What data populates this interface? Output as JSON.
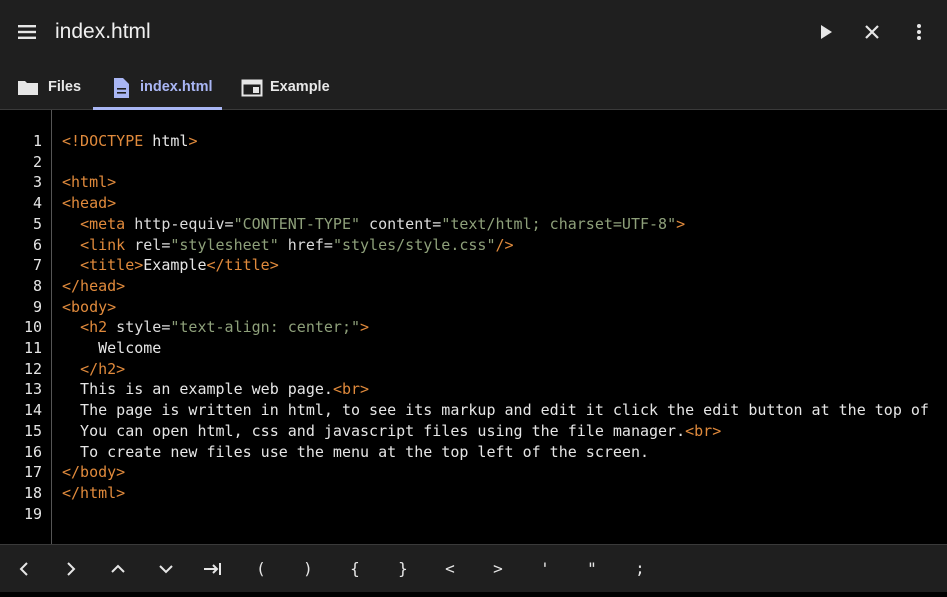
{
  "header": {
    "title": "index.html",
    "icons": {
      "menu": "hamburger-menu-icon",
      "run": "play-icon",
      "close": "close-icon",
      "more": "more-vert-icon"
    }
  },
  "tabs": [
    {
      "label": "Files",
      "icon": "folder-icon",
      "active": false
    },
    {
      "label": "index.html",
      "icon": "file-icon",
      "active": true
    },
    {
      "label": "Example",
      "icon": "web-preview-icon",
      "active": false
    }
  ],
  "colors": {
    "accent": "#a9b6f4",
    "tag": "#e08a3c",
    "string": "#8ea07a",
    "text": "#e6e6e6",
    "background": "#000000",
    "toolbar": "#1f1f1f"
  },
  "editor": {
    "lines": [
      [
        [
          "tag",
          "<!DOCTYPE"
        ],
        [
          "text",
          " html"
        ],
        [
          "tag",
          ">"
        ]
      ],
      [],
      [
        [
          "tag",
          "<html>"
        ]
      ],
      [
        [
          "tag",
          "<head>"
        ]
      ],
      [
        [
          "text",
          "  "
        ],
        [
          "tag",
          "<meta"
        ],
        [
          "attr",
          " http-equiv="
        ],
        [
          "str",
          "\"CONTENT-TYPE\""
        ],
        [
          "attr",
          " content="
        ],
        [
          "str",
          "\"text/html; charset=UTF-8\""
        ],
        [
          "tag",
          ">"
        ]
      ],
      [
        [
          "text",
          "  "
        ],
        [
          "tag",
          "<link"
        ],
        [
          "attr",
          " rel="
        ],
        [
          "str",
          "\"stylesheet\""
        ],
        [
          "attr",
          " href="
        ],
        [
          "str",
          "\"styles/style.css\""
        ],
        [
          "tag",
          "/>"
        ]
      ],
      [
        [
          "text",
          "  "
        ],
        [
          "tag",
          "<title>"
        ],
        [
          "text",
          "Example"
        ],
        [
          "tag",
          "</title>"
        ]
      ],
      [
        [
          "tag",
          "</head>"
        ]
      ],
      [
        [
          "tag",
          "<body>"
        ]
      ],
      [
        [
          "text",
          "  "
        ],
        [
          "tag",
          "<h2"
        ],
        [
          "attr",
          " style="
        ],
        [
          "str",
          "\"text-align: center;\""
        ],
        [
          "tag",
          ">"
        ]
      ],
      [
        [
          "text",
          "    Welcome"
        ]
      ],
      [
        [
          "text",
          "  "
        ],
        [
          "tag",
          "</h2>"
        ]
      ],
      [
        [
          "text",
          "  This is an example web page."
        ],
        [
          "tag",
          "<br>"
        ]
      ],
      [
        [
          "text",
          "  The page is written in html, to see its markup and edit it click the edit button at the top of"
        ]
      ],
      [
        [
          "text",
          "  You can open html, css and javascript files using the file manager."
        ],
        [
          "tag",
          "<br>"
        ]
      ],
      [
        [
          "text",
          "  To create new files use the menu at the top left of the screen."
        ]
      ],
      [
        [
          "tag",
          "</body>"
        ]
      ],
      [
        [
          "tag",
          "</html>"
        ]
      ],
      []
    ]
  },
  "keybar": {
    "keys": [
      {
        "name": "arrow-left-key",
        "label": "<",
        "icon": "chevron-left-icon"
      },
      {
        "name": "arrow-right-key",
        "label": ">",
        "icon": "chevron-right-icon"
      },
      {
        "name": "arrow-up-key",
        "label": "^",
        "icon": "chevron-up-icon"
      },
      {
        "name": "arrow-down-key",
        "label": "v",
        "icon": "chevron-down-icon"
      },
      {
        "name": "tab-key",
        "label": "→|",
        "icon": "tab-icon"
      },
      {
        "name": "open-paren-key",
        "label": "("
      },
      {
        "name": "close-paren-key",
        "label": ")"
      },
      {
        "name": "open-brace-key",
        "label": "{"
      },
      {
        "name": "close-brace-key",
        "label": "}"
      },
      {
        "name": "less-than-key",
        "label": "<"
      },
      {
        "name": "greater-than-key",
        "label": ">"
      },
      {
        "name": "single-quote-key",
        "label": "'"
      },
      {
        "name": "double-quote-key",
        "label": "\""
      },
      {
        "name": "semicolon-key",
        "label": ";"
      }
    ]
  }
}
